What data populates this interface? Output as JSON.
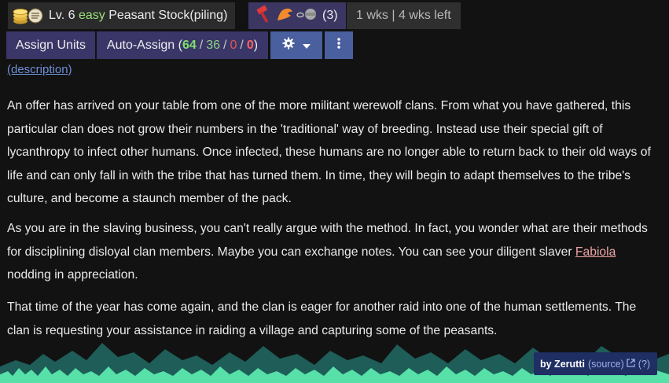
{
  "quest": {
    "level_text": "Lv. 6",
    "difficulty": "easy",
    "title": "Peasant Stock(piling)",
    "roles_count": "(3)",
    "weeks": "1 wks | 4 wks left"
  },
  "toolbar": {
    "assign_units": "Assign Units",
    "auto_assign_label": "Auto-Assign (",
    "num1": "64",
    "num2": "36",
    "num3": "0",
    "num4": "0",
    "slash": "/",
    "close_paren": ")"
  },
  "description_link": "(description)",
  "paragraphs": {
    "p1": "An offer has arrived on your table from one of the more militant werewolf clans. From what you have gathered, this particular clan does not grow their numbers in the 'traditional' way of breeding. Instead use their special gift of lycanthropy to infect other humans. Once infected, these humans are no longer able to return back to their old ways of life and can only fall in with the tribe that has turned them. In time, they will begin to adapt themselves to the tribe's culture, and become a staunch member of the pack.",
    "p2_before": "As you are in the slaving business, you can't really argue with the method. In fact, you wonder what are their methods for disciplining disloyal clan members. Maybe you can exchange notes. You can see your diligent slaver ",
    "p2_name": "Fabiola",
    "p2_after": " nodding in appreciation.",
    "p3": "That time of the year has come again, and the clan is eager for another raid into one of the human settlements. The clan is requesting your assistance in raiding a village and capturing some of the peasants."
  },
  "credit": {
    "by": "by Zerutti",
    "source": "(source)",
    "help": "(?)"
  },
  "colors": {
    "background": "#121212",
    "button": "#3a3668",
    "accent_button": "#4a5f9e",
    "green": "#7de06a",
    "red": "#e05656",
    "mountain_teal": "#1e5d58",
    "grass": "#57e0a8"
  },
  "icons": [
    "coins-icon",
    "scroll-icon",
    "hammer-icon",
    "muscle-icon",
    "chain-icon",
    "gear-icon",
    "caret-down-icon",
    "vertical-ellipsis-icon",
    "external-link-icon"
  ]
}
